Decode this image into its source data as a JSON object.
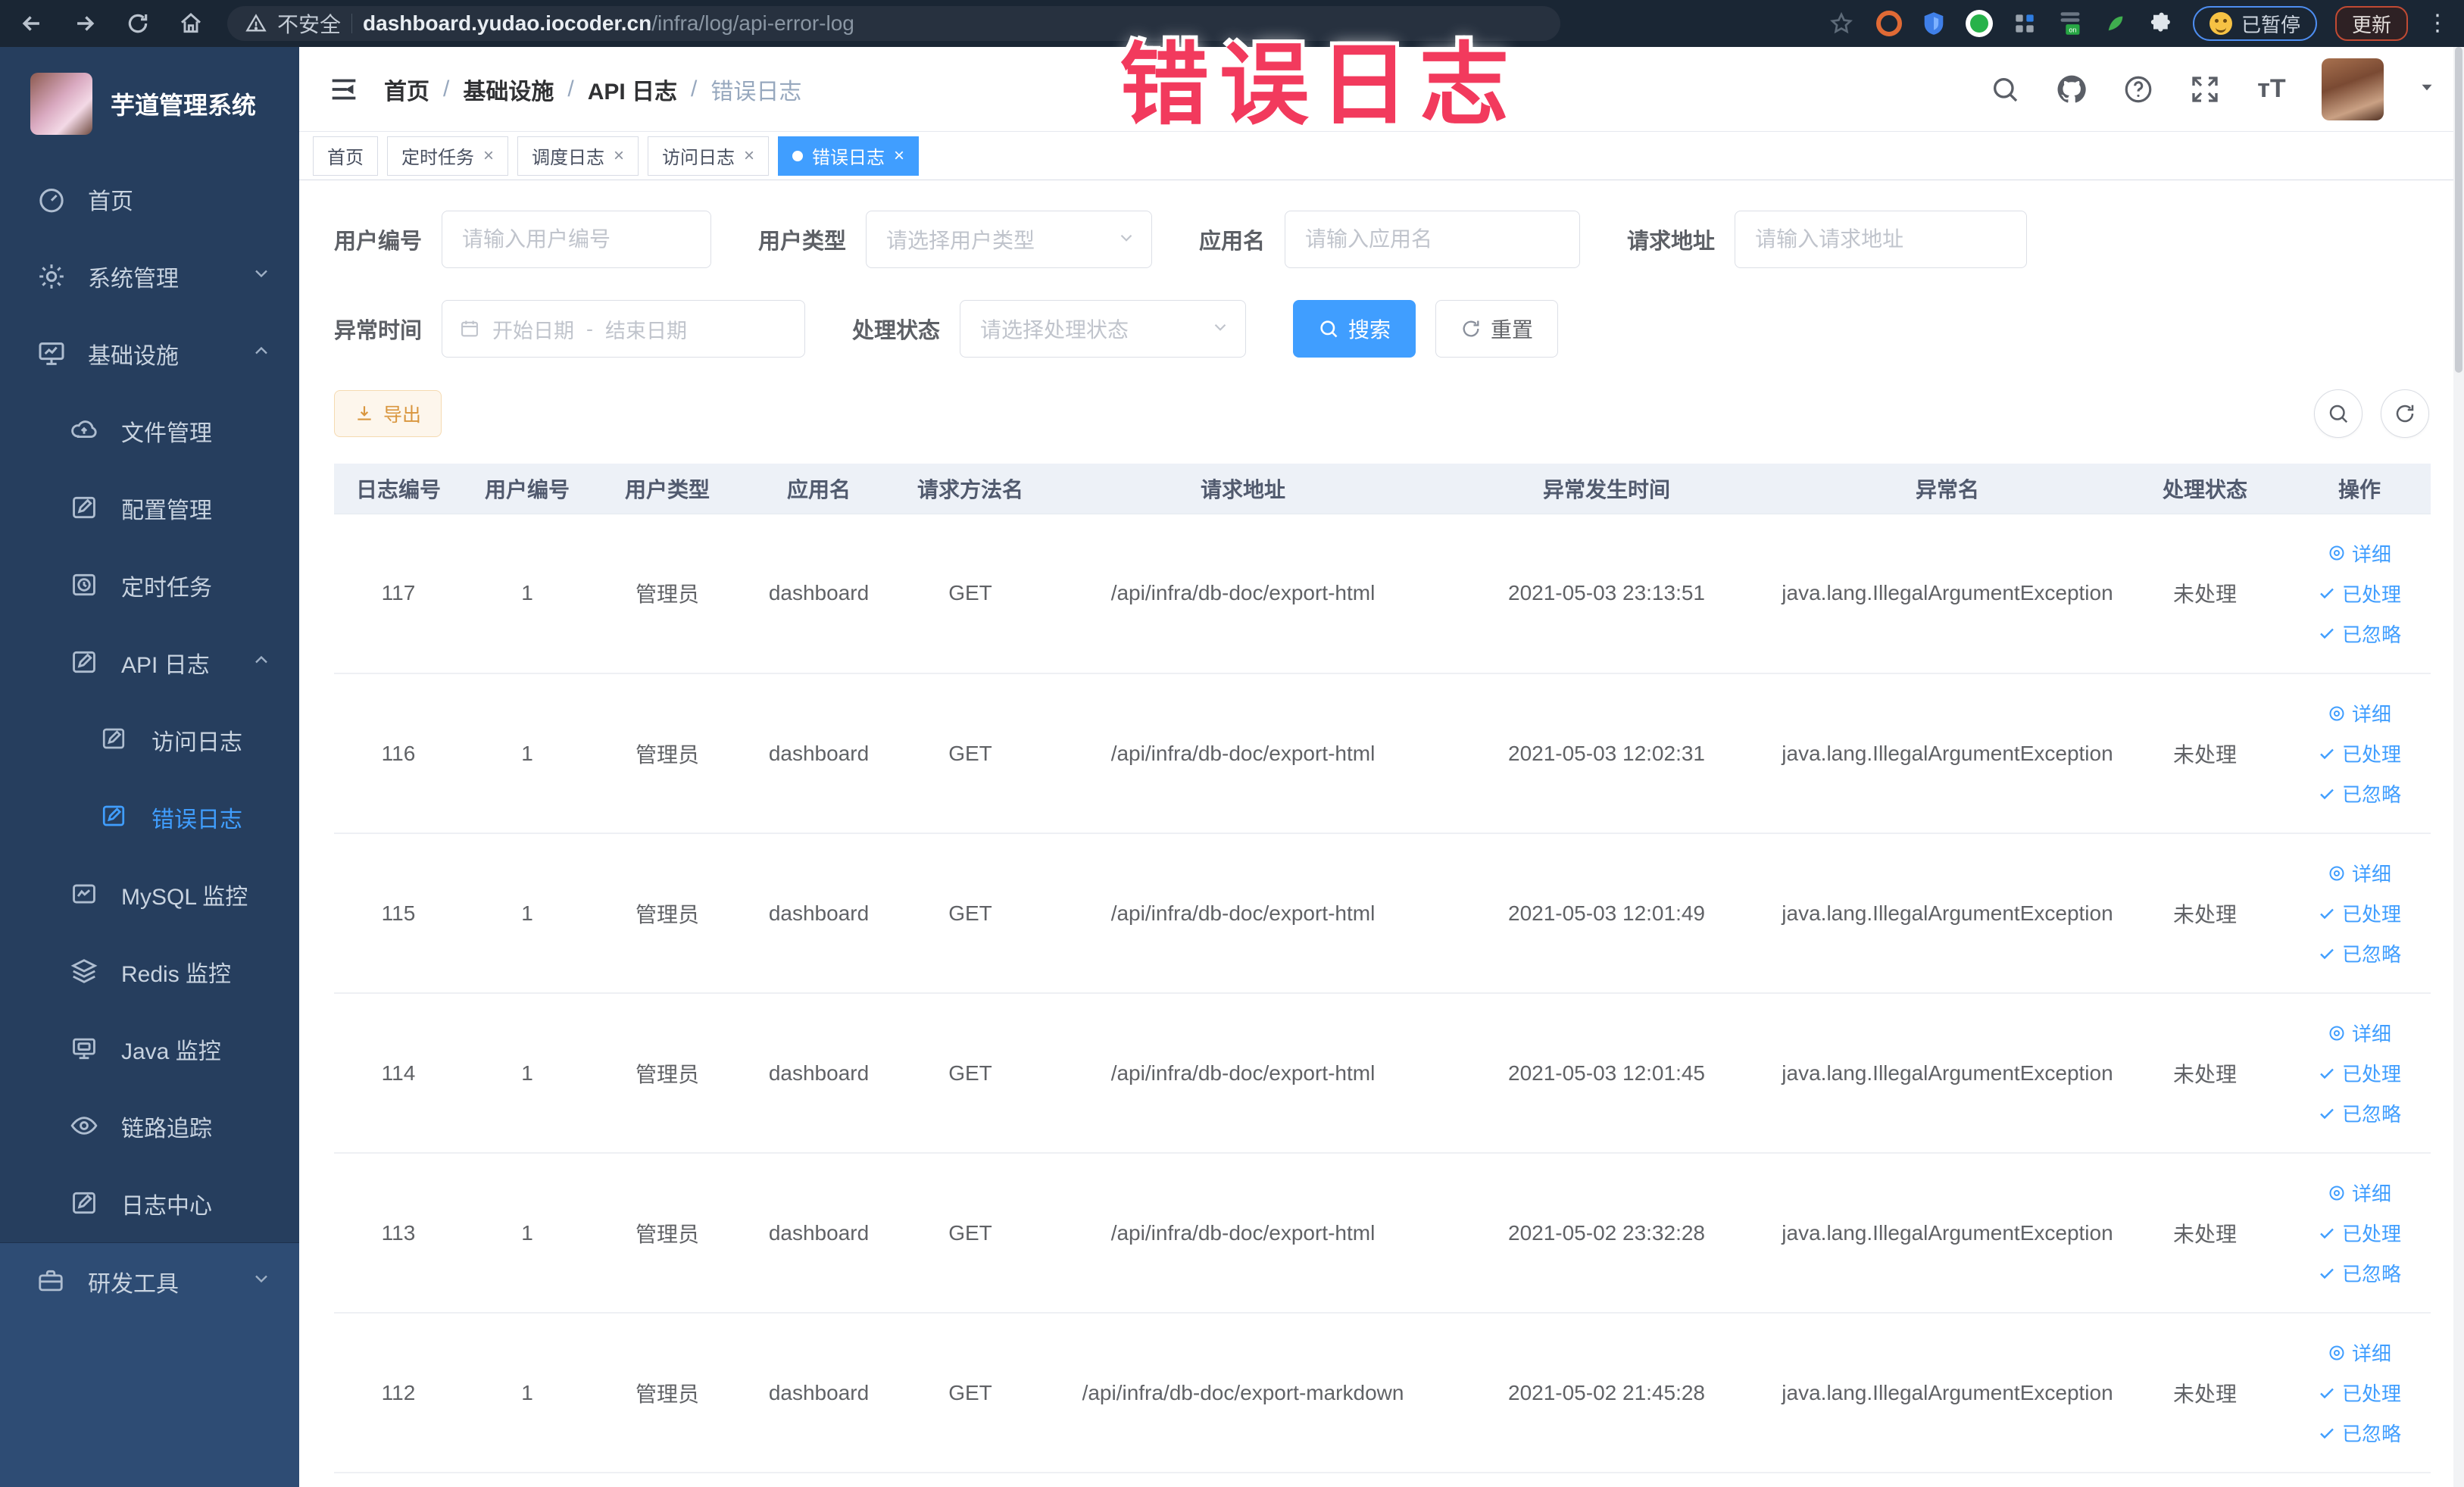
{
  "browser": {
    "security_label": "不安全",
    "url_host": "dashboard.yudao.iocoder.cn",
    "url_path": "/infra/log/api-error-log",
    "paused_label": "已暂停",
    "update_label": "更新"
  },
  "annotation": {
    "text": "错误日志",
    "color": "#f23a5d"
  },
  "sidebar": {
    "logo_title": "芋道管理系统",
    "items": [
      {
        "label": "首页"
      },
      {
        "label": "系统管理"
      },
      {
        "label": "基础设施"
      },
      {
        "label": "文件管理"
      },
      {
        "label": "配置管理"
      },
      {
        "label": "定时任务"
      },
      {
        "label": "API 日志"
      },
      {
        "label": "访问日志"
      },
      {
        "label": "错误日志"
      },
      {
        "label": "MySQL 监控"
      },
      {
        "label": "Redis 监控"
      },
      {
        "label": "Java 监控"
      },
      {
        "label": "链路追踪"
      },
      {
        "label": "日志中心"
      },
      {
        "label": "研发工具"
      }
    ]
  },
  "breadcrumb": {
    "items": [
      "首页",
      "基础设施",
      "API 日志",
      "错误日志"
    ],
    "separator": "/"
  },
  "tags": [
    {
      "label": "首页"
    },
    {
      "label": "定时任务"
    },
    {
      "label": "调度日志"
    },
    {
      "label": "访问日志"
    },
    {
      "label": "错误日志"
    }
  ],
  "filters": {
    "user_id": {
      "label": "用户编号",
      "placeholder": "请输入用户编号"
    },
    "user_type": {
      "label": "用户类型",
      "placeholder": "请选择用户类型"
    },
    "app_name": {
      "label": "应用名",
      "placeholder": "请输入应用名"
    },
    "request_url": {
      "label": "请求地址",
      "placeholder": "请输入请求地址"
    },
    "exception_time": {
      "label": "异常时间",
      "start_placeholder": "开始日期",
      "separator": "-",
      "end_placeholder": "结束日期"
    },
    "process_status": {
      "label": "处理状态",
      "placeholder": "请选择处理状态"
    },
    "search_label": "搜索",
    "reset_label": "重置"
  },
  "toolbar": {
    "export_label": "导出"
  },
  "table": {
    "columns": [
      "日志编号",
      "用户编号",
      "用户类型",
      "应用名",
      "请求方法名",
      "请求地址",
      "异常发生时间",
      "异常名",
      "处理状态",
      "操作"
    ],
    "actions": {
      "detail": "详细",
      "processed": "已处理",
      "ignored": "已忽略"
    },
    "rows": [
      {
        "id": "117",
        "user_id": "1",
        "user_type": "管理员",
        "app_name": "dashboard",
        "method": "GET",
        "url": "/api/infra/db-doc/export-html",
        "time": "2021-05-03 23:13:51",
        "exception": "java.lang.IllegalArgumentException",
        "status": "未处理"
      },
      {
        "id": "116",
        "user_id": "1",
        "user_type": "管理员",
        "app_name": "dashboard",
        "method": "GET",
        "url": "/api/infra/db-doc/export-html",
        "time": "2021-05-03 12:02:31",
        "exception": "java.lang.IllegalArgumentException",
        "status": "未处理"
      },
      {
        "id": "115",
        "user_id": "1",
        "user_type": "管理员",
        "app_name": "dashboard",
        "method": "GET",
        "url": "/api/infra/db-doc/export-html",
        "time": "2021-05-03 12:01:49",
        "exception": "java.lang.IllegalArgumentException",
        "status": "未处理"
      },
      {
        "id": "114",
        "user_id": "1",
        "user_type": "管理员",
        "app_name": "dashboard",
        "method": "GET",
        "url": "/api/infra/db-doc/export-html",
        "time": "2021-05-03 12:01:45",
        "exception": "java.lang.IllegalArgumentException",
        "status": "未处理"
      },
      {
        "id": "113",
        "user_id": "1",
        "user_type": "管理员",
        "app_name": "dashboard",
        "method": "GET",
        "url": "/api/infra/db-doc/export-html",
        "time": "2021-05-02 23:32:28",
        "exception": "java.lang.IllegalArgumentException",
        "status": "未处理"
      },
      {
        "id": "112",
        "user_id": "1",
        "user_type": "管理员",
        "app_name": "dashboard",
        "method": "GET",
        "url": "/api/infra/db-doc/export-markdown",
        "time": "2021-05-02 21:45:28",
        "exception": "java.lang.IllegalArgumentException",
        "status": "未处理"
      }
    ]
  }
}
